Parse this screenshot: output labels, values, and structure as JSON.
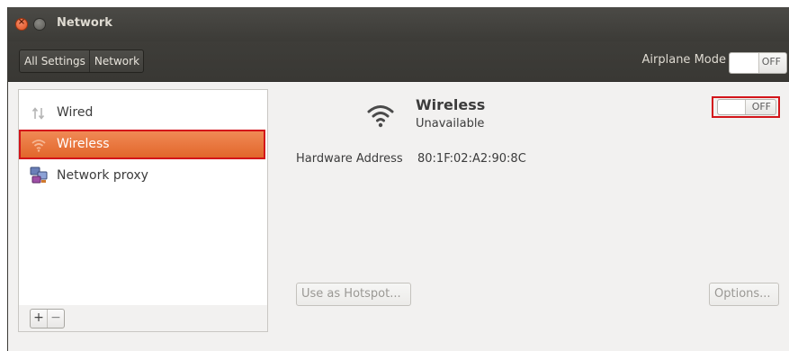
{
  "window": {
    "title": "Network"
  },
  "toolbar": {
    "breadcrumbs": [
      "All Settings",
      "Network"
    ],
    "airplane_label": "Airplane Mode",
    "airplane_state": "OFF"
  },
  "sidebar": {
    "items": [
      {
        "label": "Wired",
        "icon": "wired-network-icon",
        "selected": false
      },
      {
        "label": "Wireless",
        "icon": "wifi-icon",
        "selected": true
      },
      {
        "label": "Network proxy",
        "icon": "network-proxy-icon",
        "selected": false
      }
    ],
    "add_label": "+",
    "remove_label": "−"
  },
  "device": {
    "name": "Wireless",
    "status": "Unavailable",
    "toggle_state": "OFF",
    "hardware_label": "Hardware Address",
    "hardware_value": "80:1F:02:A2:90:8C",
    "hotspot_button": "Use as Hotspot...",
    "options_button": "Options..."
  },
  "colors": {
    "titlebar": "#3c3b37",
    "selection": "#e2662b",
    "highlight_box": "#d3151a",
    "window_bg": "#f2f1f0"
  }
}
